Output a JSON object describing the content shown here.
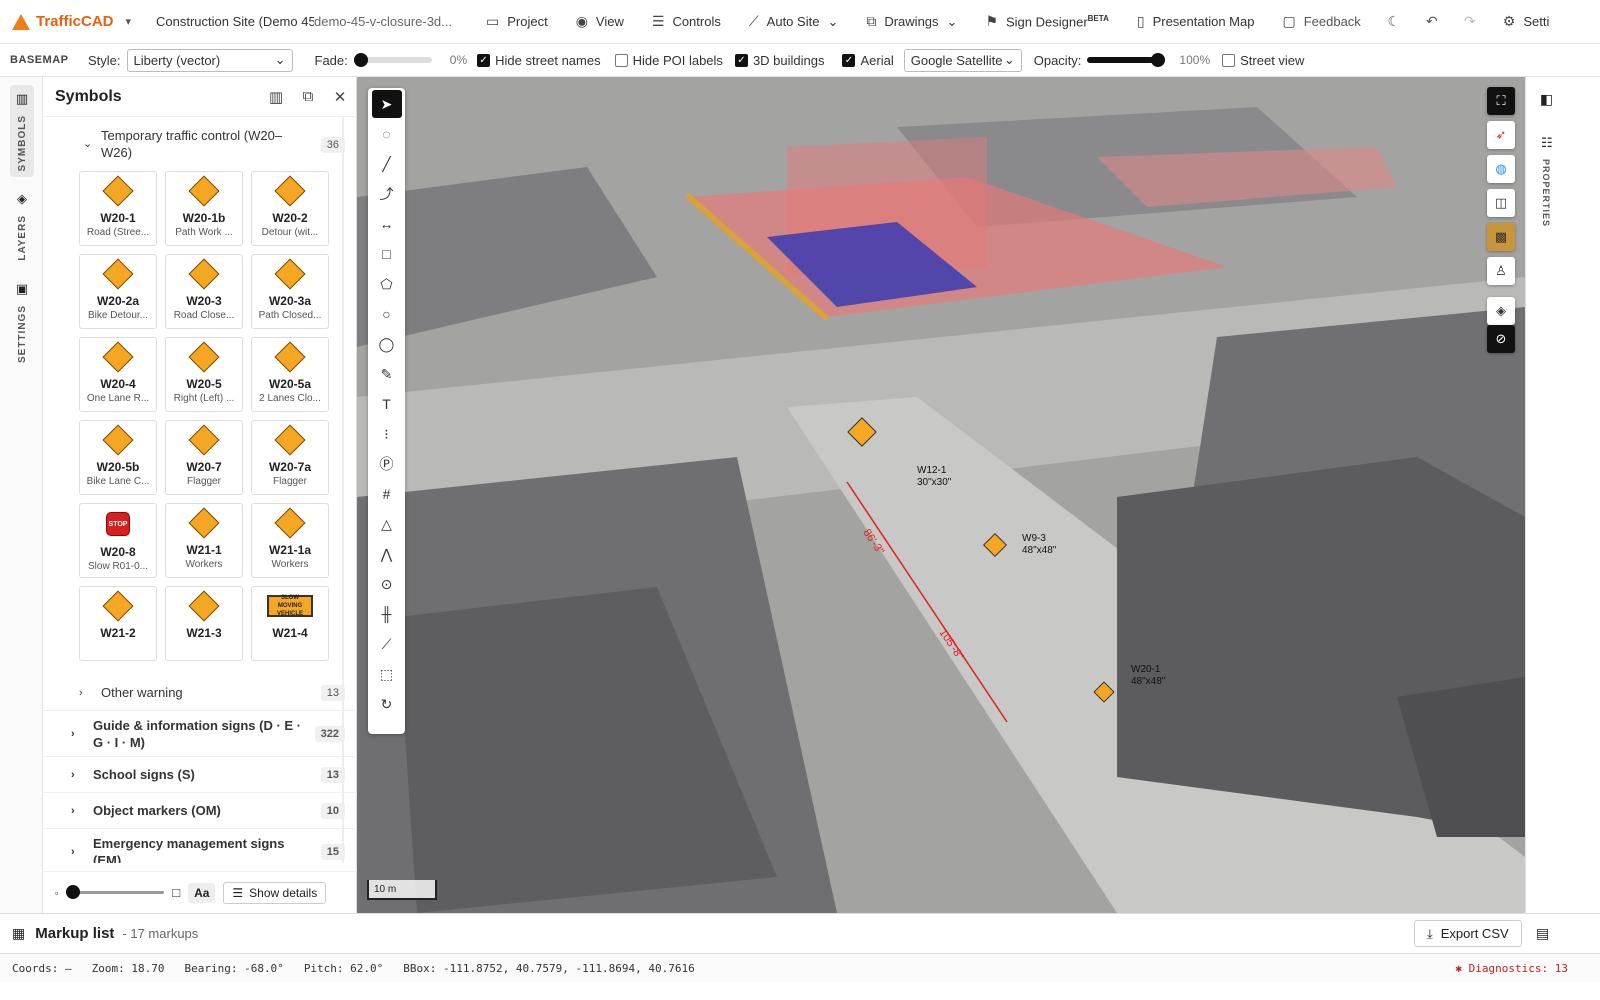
{
  "topbar": {
    "brand": "TrafficCAD",
    "project_title": "Construction Site (Demo 45",
    "project_id": "demo-45-v-closure-3d...",
    "menus": [
      {
        "label": "Project",
        "icon": "folder-icon"
      },
      {
        "label": "View",
        "icon": "eye-icon"
      },
      {
        "label": "Controls",
        "icon": "sliders-icon"
      },
      {
        "label": "Auto Site",
        "icon": "wand-icon"
      },
      {
        "label": "Drawings",
        "icon": "layers-icon"
      },
      {
        "label": "Sign Designer",
        "icon": "signpost-icon",
        "sup": "BETA"
      },
      {
        "label": "Presentation Map",
        "icon": "book-icon"
      },
      {
        "label": "Feedback",
        "icon": "comment-icon"
      }
    ],
    "settings": "Setti"
  },
  "basemap": {
    "label": "BASEMAP",
    "style_label": "Style:",
    "style_value": "Liberty (vector)",
    "fade_label": "Fade:",
    "fade_value": "0%",
    "fade_level": 0,
    "hide_street_names": "Hide street names",
    "hide_poi": "Hide POI labels",
    "buildings_3d": "3D buildings",
    "aerial": "Aerial",
    "imagery_value": "Google Satellite",
    "opacity_label": "Opacity:",
    "opacity_value": "100%",
    "opacity_level": 1,
    "street_view": "Street view"
  },
  "rail": {
    "symbols": "SYMBOLS",
    "layers": "LAYERS",
    "settings": "SETTINGS"
  },
  "panel": {
    "title": "Symbols",
    "open_category": {
      "name": "Temporary traffic control (W20–W26)",
      "count": "36"
    },
    "signs": [
      {
        "code": "W20-1",
        "desc": "Road (Stree...",
        "kind": "diamond"
      },
      {
        "code": "W20-1b",
        "desc": "Path Work ...",
        "kind": "diamond"
      },
      {
        "code": "W20-2",
        "desc": "Detour (wit...",
        "kind": "diamond"
      },
      {
        "code": "W20-2a",
        "desc": "Bike Detour...",
        "kind": "diamond"
      },
      {
        "code": "W20-3",
        "desc": "Road Close...",
        "kind": "diamond"
      },
      {
        "code": "W20-3a",
        "desc": "Path Closed...",
        "kind": "diamond"
      },
      {
        "code": "W20-4",
        "desc": "One Lane R...",
        "kind": "diamond"
      },
      {
        "code": "W20-5",
        "desc": "Right (Left) ...",
        "kind": "diamond"
      },
      {
        "code": "W20-5a",
        "desc": "2 Lanes Clo...",
        "kind": "diamond"
      },
      {
        "code": "W20-5b",
        "desc": "Bike Lane C...",
        "kind": "diamond"
      },
      {
        "code": "W20-7",
        "desc": "Flagger",
        "kind": "diamond"
      },
      {
        "code": "W20-7a",
        "desc": "Flagger",
        "kind": "diamond"
      },
      {
        "code": "W20-8",
        "desc": "Slow R01-0...",
        "kind": "stop"
      },
      {
        "code": "W21-1",
        "desc": "Workers",
        "kind": "diamond"
      },
      {
        "code": "W21-1a",
        "desc": "Workers",
        "kind": "diamond"
      },
      {
        "code": "W21-2",
        "desc": "",
        "kind": "diamond"
      },
      {
        "code": "W21-3",
        "desc": "",
        "kind": "diamond"
      },
      {
        "code": "W21-4",
        "desc": "",
        "kind": "rect"
      }
    ],
    "stop_text": "STOP",
    "slow_text": "SLOW MOVING VEHICLE",
    "categories": [
      {
        "name": "Other warning",
        "count": "13"
      },
      {
        "name": "Guide & information signs (D · E · G · I · M)",
        "count": "322"
      },
      {
        "name": "School signs (S)",
        "count": "13"
      },
      {
        "name": "Object markers (OM)",
        "count": "10"
      },
      {
        "name": "Emergency management signs (EM)",
        "count": "15"
      }
    ],
    "footer": {
      "aa": "Aa",
      "show_details": "Show details",
      "size_level": 0
    }
  },
  "map": {
    "scale": "10 m",
    "labels": [
      {
        "code": "W12-1",
        "size": "30\"x30\""
      },
      {
        "code": "W9-3",
        "size": "48\"x48\""
      },
      {
        "code": "W20-1",
        "size": "48\"x48\""
      }
    ],
    "dims": [
      "86'-3\"",
      "105'-8\""
    ]
  },
  "right_rail": {
    "properties": "PROPERTIES"
  },
  "markup": {
    "title": "Markup list",
    "count": "- 17 markups",
    "export": "Export CSV"
  },
  "status": {
    "coords": "Coords: —",
    "zoom": "Zoom: 18.70",
    "bearing": "Bearing: -68.0°",
    "pitch": "Pitch: 62.0°",
    "bbox": "BBox: -111.8752, 40.7579, -111.8694, 40.7616",
    "diagnostics": "Diagnostics: 13"
  },
  "colors": {
    "brand": "#f07c1a",
    "sign": "#f5a623",
    "dimension": "#e02020",
    "closure": "#e87878",
    "work_zone": "#3b3bb0"
  }
}
